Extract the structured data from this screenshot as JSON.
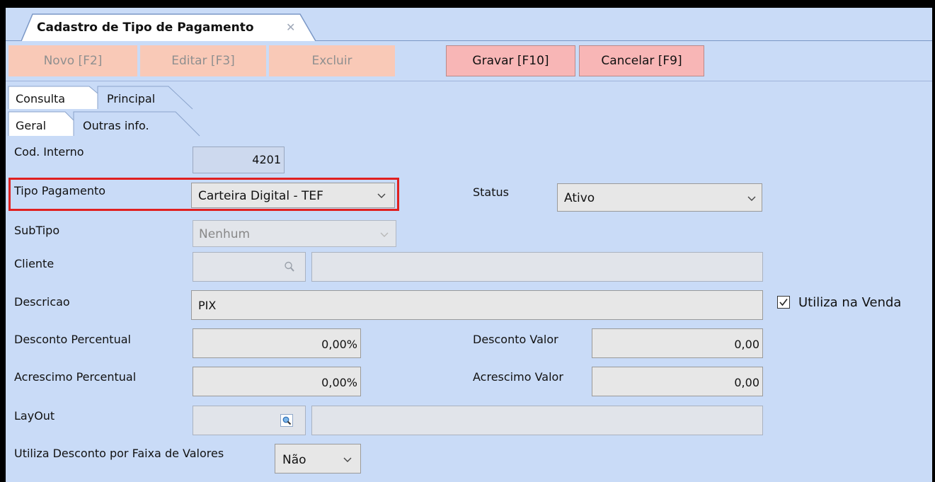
{
  "window": {
    "tab_title": "Cadastro de Tipo de Pagamento",
    "tab_close": "✕"
  },
  "toolbar": {
    "novo": "Novo [F2]",
    "editar": "Editar [F3]",
    "excluir": "Excluir",
    "gravar": "Gravar [F10]",
    "cancelar": "Cancelar [F9]"
  },
  "tabs": {
    "row1": [
      "Consulta",
      "Principal"
    ],
    "row2": [
      "Geral",
      "Outras info."
    ]
  },
  "form": {
    "cod_interno": {
      "label": "Cod. Interno",
      "value": "4201"
    },
    "tipo_pagamento": {
      "label": "Tipo  Pagamento",
      "value": "Carteira Digital - TEF"
    },
    "status": {
      "label": "Status",
      "value": "Ativo"
    },
    "subtipo": {
      "label": "SubTipo",
      "value": "Nenhum"
    },
    "cliente": {
      "label": "Cliente",
      "code": "",
      "name": ""
    },
    "descricao": {
      "label": "Descricao",
      "value": "PIX"
    },
    "utiliza_na_venda": {
      "label": "Utiliza na Venda",
      "checked": true
    },
    "desconto_percentual": {
      "label": "Desconto Percentual",
      "value": "0,00%"
    },
    "desconto_valor": {
      "label": "Desconto Valor",
      "value": "0,00"
    },
    "acrescimo_percentual": {
      "label": "Acrescimo Percentual",
      "value": "0,00%"
    },
    "acrescimo_valor": {
      "label": "Acrescimo Valor",
      "value": "0,00"
    },
    "layout": {
      "label": "LayOut",
      "code": "",
      "name": ""
    },
    "faixa_valores": {
      "label": "Utiliza Desconto por Faixa de Valores",
      "value": "Não"
    }
  },
  "colors": {
    "panel": "#c9dbf7",
    "highlight": "#e02020",
    "button_enabled": "#f8b6b6",
    "button_disabled": "#f9c9b7"
  },
  "icons": {
    "search": "search-icon",
    "chevron": "chevron-down-icon",
    "check": "check-icon",
    "close": "close-icon"
  }
}
